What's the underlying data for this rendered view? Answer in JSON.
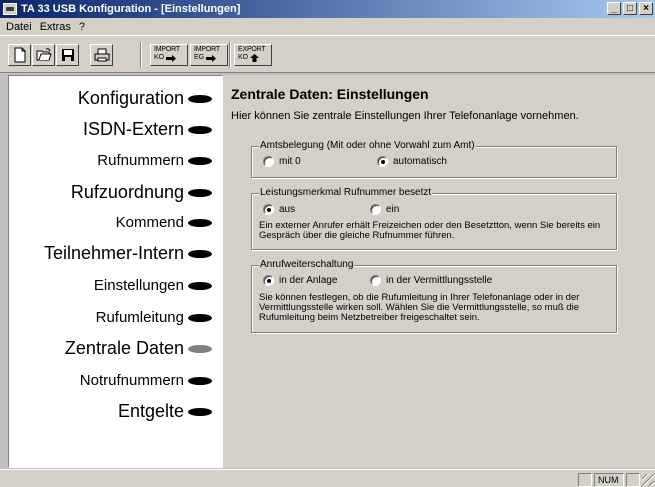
{
  "window": {
    "title": "TA 33 USB Konfiguration - [Einstellungen]",
    "buttons": {
      "minimize": "_",
      "maximize": "□",
      "close": "×"
    }
  },
  "menu": [
    {
      "label": "Datei"
    },
    {
      "label": "Extras"
    },
    {
      "label": "?"
    }
  ],
  "toolbar": {
    "buttons": [
      {
        "icon": "new-document-icon"
      },
      {
        "icon": "open-folder-icon"
      },
      {
        "icon": "save-disk-icon"
      },
      {
        "icon": "printer-icon"
      }
    ],
    "import_ko": {
      "line1": "IMPORT",
      "line2": "KO"
    },
    "import_eg": {
      "line1": "IMPORT",
      "line2": "EG"
    },
    "export_ko": {
      "line1": "EXPORT",
      "line2": "KO"
    }
  },
  "nav": [
    {
      "label": "Konfiguration",
      "active": false
    },
    {
      "label": "ISDN-Extern",
      "active": false
    },
    {
      "label": "Rufnummern",
      "active": false
    },
    {
      "label": "Rufzuordnung",
      "active": false
    },
    {
      "label": "Kommend",
      "active": false
    },
    {
      "label": "Teilnehmer-Intern",
      "active": false
    },
    {
      "label": "Einstellungen",
      "active": false
    },
    {
      "label": "Rufumleitung",
      "active": false
    },
    {
      "label": "Zentrale Daten",
      "active": true
    },
    {
      "label": "Notrufnummern",
      "active": false
    },
    {
      "label": "Entgelte",
      "active": false
    }
  ],
  "main": {
    "title": "Zentrale Daten: Einstellungen",
    "subtitle": "Hier können Sie zentrale Einstellungen Ihrer Telefonanlage vornehmen.",
    "groups": [
      {
        "legend": "Amtsbelegung (Mit oder ohne Vorwahl zum Amt)",
        "options": [
          {
            "label": "mit 0",
            "checked": false
          },
          {
            "label": "automatisch",
            "checked": true
          }
        ],
        "description": ""
      },
      {
        "legend": "Leistungsmerkmal Rufnummer besetzt",
        "options": [
          {
            "label": "aus",
            "checked": true
          },
          {
            "label": "ein",
            "checked": false
          }
        ],
        "description": "Ein externer Anrufer erhält Freizeichen oder den Besetztton, wenn Sie bereits ein Gespräch über die gleiche Rufnummer führen."
      },
      {
        "legend": "Anrufweiterschaltung",
        "options": [
          {
            "label": "in der Anlage",
            "checked": true
          },
          {
            "label": "in der Vermittlungsstelle",
            "checked": false
          }
        ],
        "description": "Sie können festlegen, ob die Rufumleitung in Ihrer Telefonanlage oder in der Vermittlungsstelle wirken soll. Wählen Sie die Vermittlungsstelle, so muß die Rufumleitung beim Netzbetreiber freigeschaltet sein."
      }
    ]
  },
  "status": {
    "num": "NUM"
  },
  "colors": {
    "titlebar_start": "#08246b",
    "titlebar_end": "#a5caf0",
    "face": "#d4d0c8",
    "nav_bg": "#ffffff",
    "bullet": "#000000",
    "bullet_active": "#808080"
  }
}
